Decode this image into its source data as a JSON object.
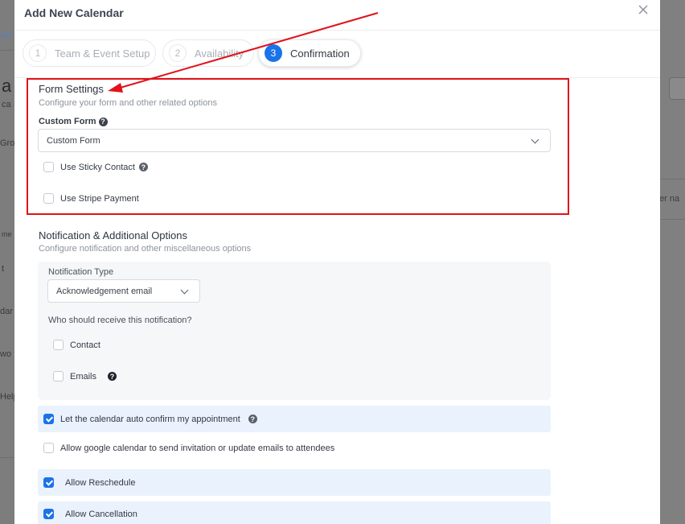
{
  "background": {
    "tab_fragment": "ale",
    "heading_fragment": "a",
    "sub_fragment": "ca",
    "group_fragment": "Grou",
    "col_fragment": "me",
    "right_col_fragment": "er na",
    "row1_fragment": "t",
    "row2_fragment": "dar",
    "row3_fragment": "wo",
    "row4_fragment": "Help"
  },
  "modal": {
    "title": "Add New Calendar",
    "close_icon": "close-icon"
  },
  "steps": [
    {
      "number": "1",
      "label": "Team & Event Setup",
      "active": false
    },
    {
      "number": "2",
      "label": "Availability",
      "active": false
    },
    {
      "number": "3",
      "label": "Confirmation",
      "active": true
    }
  ],
  "form_settings": {
    "title": "Form Settings",
    "subtitle": "Configure your form and other related options",
    "custom_form_label": "Custom Form",
    "custom_form_value": "Custom Form",
    "sticky_contact_label": "Use Sticky Contact",
    "sticky_contact_checked": false,
    "stripe_payment_label": "Use Stripe Payment",
    "stripe_payment_checked": false
  },
  "notification": {
    "title": "Notification & Additional Options",
    "subtitle": "Configure notification and other miscellaneous options",
    "type_label": "Notification Type",
    "type_value": "Acknowledgement email",
    "recipients_label": "Who should receive this notification?",
    "contact_label": "Contact",
    "emails_label": "Emails"
  },
  "options": {
    "auto_confirm_label": "Let the calendar auto confirm my appointment",
    "auto_confirm_checked": true,
    "google_invite_label": "Allow google calendar to send invitation or update emails to attendees",
    "google_invite_checked": false,
    "allow_reschedule_label": "Allow Reschedule",
    "allow_reschedule_checked": true,
    "allow_cancellation_label": "Allow Cancellation",
    "allow_cancellation_checked": true
  },
  "colors": {
    "accent": "#1a73e8",
    "annotation": "#e0121a"
  }
}
